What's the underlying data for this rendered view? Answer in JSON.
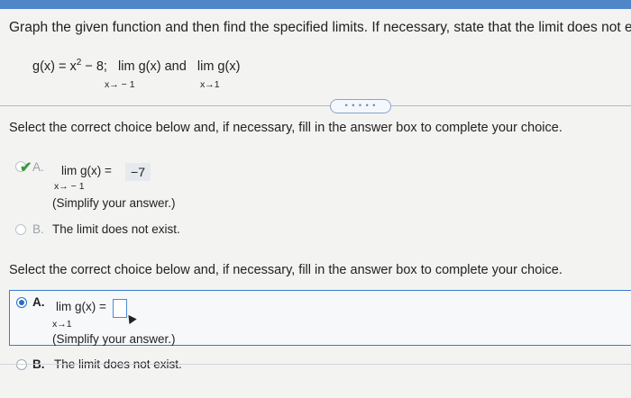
{
  "question": "Graph the given function and then find the specified limits. If necessary, state that the limit does not exist.",
  "function_line": {
    "g_def": "g(x) = x",
    "exponent": "2",
    "g_rest": " − 8;",
    "lim1": "lim  g(x) and",
    "lim1_sub": "x→ − 1",
    "lim2": "lim  g(x)",
    "lim2_sub": "x→1"
  },
  "expand_button": "• • • • •",
  "part1": {
    "prompt": "Select the correct choice below and, if necessary, fill in the answer box to complete your choice.",
    "option_a": {
      "letter": "A.",
      "expression": "lim  g(x) =",
      "sub": "x→ − 1",
      "answer": "−7",
      "hint": "(Simplify your answer.)",
      "status": "correct"
    },
    "option_b": {
      "letter": "B.",
      "text": "The limit does not exist."
    }
  },
  "part2": {
    "prompt": "Select the correct choice below and, if necessary, fill in the answer box to complete your choice.",
    "option_a": {
      "letter": "A.",
      "expression": "lim g(x) =",
      "sub": "x→1",
      "answer": "",
      "hint": "(Simplify your answer.)",
      "selected": true
    },
    "option_b": {
      "letter": "B.",
      "text": "The limit does not exist."
    }
  },
  "colors": {
    "accent": "#2a6fc4",
    "check": "#3a9a3a",
    "top_bar": "#4f86c9"
  }
}
